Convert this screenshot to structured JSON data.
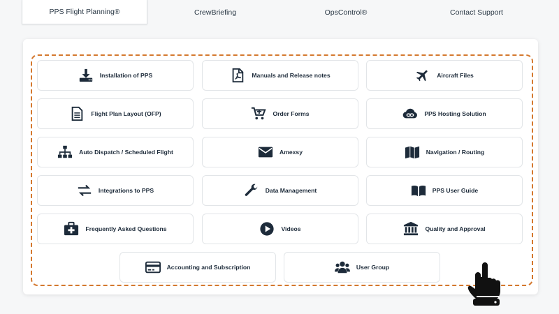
{
  "tabs": [
    {
      "label": "PPS Flight Planning®",
      "active": true
    },
    {
      "label": "CrewBriefing",
      "active": false
    },
    {
      "label": "OpsControl®",
      "active": false
    },
    {
      "label": "Contact Support",
      "active": false
    }
  ],
  "cards": [
    {
      "label": "Installation of PPS",
      "icon": "download-icon"
    },
    {
      "label": "Manuals and Release notes",
      "icon": "pdf-file-icon"
    },
    {
      "label": "Aircraft Files",
      "icon": "airplane-icon"
    },
    {
      "label": "Flight Plan Layout (OFP)",
      "icon": "document-icon"
    },
    {
      "label": "Order Forms",
      "icon": "cart-plus-icon"
    },
    {
      "label": "PPS Hosting Solution",
      "icon": "cloud-link-icon"
    },
    {
      "label": "Auto Dispatch / Scheduled Flight",
      "icon": "sitemap-icon"
    },
    {
      "label": "Amexsy",
      "icon": "envelope-icon"
    },
    {
      "label": "Navigation / Routing",
      "icon": "map-icon"
    },
    {
      "label": "Integrations to PPS",
      "icon": "exchange-arrows-icon"
    },
    {
      "label": "Data Management",
      "icon": "wrench-icon"
    },
    {
      "label": "PPS User Guide",
      "icon": "open-book-icon"
    },
    {
      "label": "Frequently Asked Questions",
      "icon": "first-aid-kit-icon"
    },
    {
      "label": "Videos",
      "icon": "play-circle-icon"
    },
    {
      "label": "Quality and Approval",
      "icon": "institution-icon"
    },
    {
      "label": "Accounting and Subscription",
      "icon": "credit-card-icon"
    },
    {
      "label": "User Group",
      "icon": "users-icon"
    }
  ],
  "colors": {
    "accent_dashed": "#d4782e",
    "icon": "#1d2b3a"
  }
}
